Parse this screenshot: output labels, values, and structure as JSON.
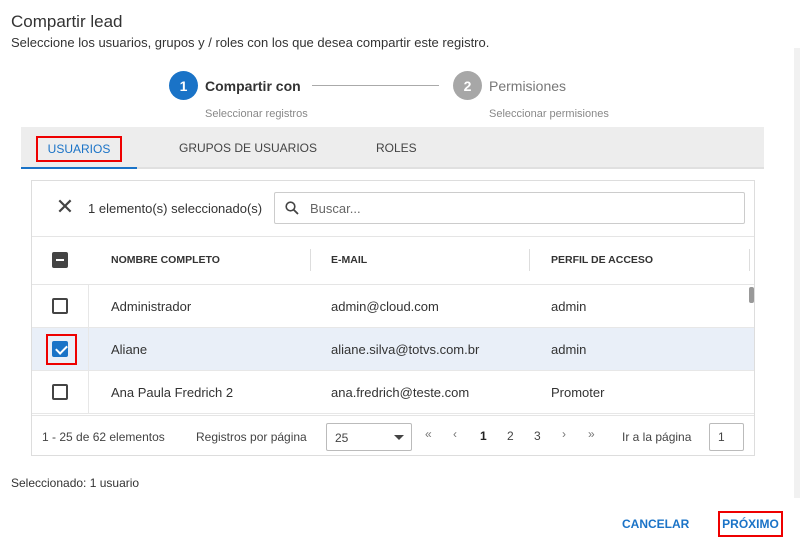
{
  "dialog": {
    "title": "Compartir lead",
    "subtitle": "Seleccione los usuarios, grupos y / roles con los que desea compartir este registro."
  },
  "stepper": {
    "steps": [
      {
        "number": "1",
        "label": "Compartir con",
        "sub": "Seleccionar registros",
        "state": "active",
        "color": "#1a73c7"
      },
      {
        "number": "2",
        "label": "Permisiones",
        "sub": "Seleccionar permisiones",
        "state": "inactive",
        "color": "#a7a7a7"
      }
    ]
  },
  "tabs": [
    {
      "label": "USUARIOS",
      "active": true
    },
    {
      "label": "GRUPOS DE USUARIOS",
      "active": false
    },
    {
      "label": "ROLES",
      "active": false
    }
  ],
  "toolbar": {
    "close_icon": "close-icon",
    "selected_text": "1 elemento(s) seleccionado(s)",
    "search_placeholder": "Buscar...",
    "search_value": ""
  },
  "table": {
    "columns": [
      "NOMBRE COMPLETO",
      "E-MAIL",
      "PERFIL DE ACCESO"
    ],
    "header_checkbox": "indeterminate",
    "rows": [
      {
        "name": "Administrador",
        "email": "admin@cloud.com",
        "profile": "admin",
        "checked": false
      },
      {
        "name": "Aliane",
        "email": "aliane.silva@totvs.com.br",
        "profile": "admin",
        "checked": true
      },
      {
        "name": "Ana Paula Fredrich 2",
        "email": "ana.fredrich@teste.com",
        "profile": "Promoter",
        "checked": false
      }
    ]
  },
  "pagination": {
    "range_text": "1 - 25 de 62 elementos",
    "page_size_label": "Registros por página",
    "page_size": "25",
    "first": "«",
    "prev": "‹",
    "pages": [
      "1",
      "2",
      "3"
    ],
    "current_page": "1",
    "next": "›",
    "last": "»",
    "goto_label": "Ir a la página",
    "goto_value": "1"
  },
  "footer": {
    "selected_summary": "Seleccionado: 1 usuario",
    "cancel_label": "CANCELAR",
    "next_label": "PRÓXIMO"
  },
  "colors": {
    "primary": "#1a73c7",
    "highlight": "#ee0000",
    "selected_row": "#e9eff8"
  }
}
